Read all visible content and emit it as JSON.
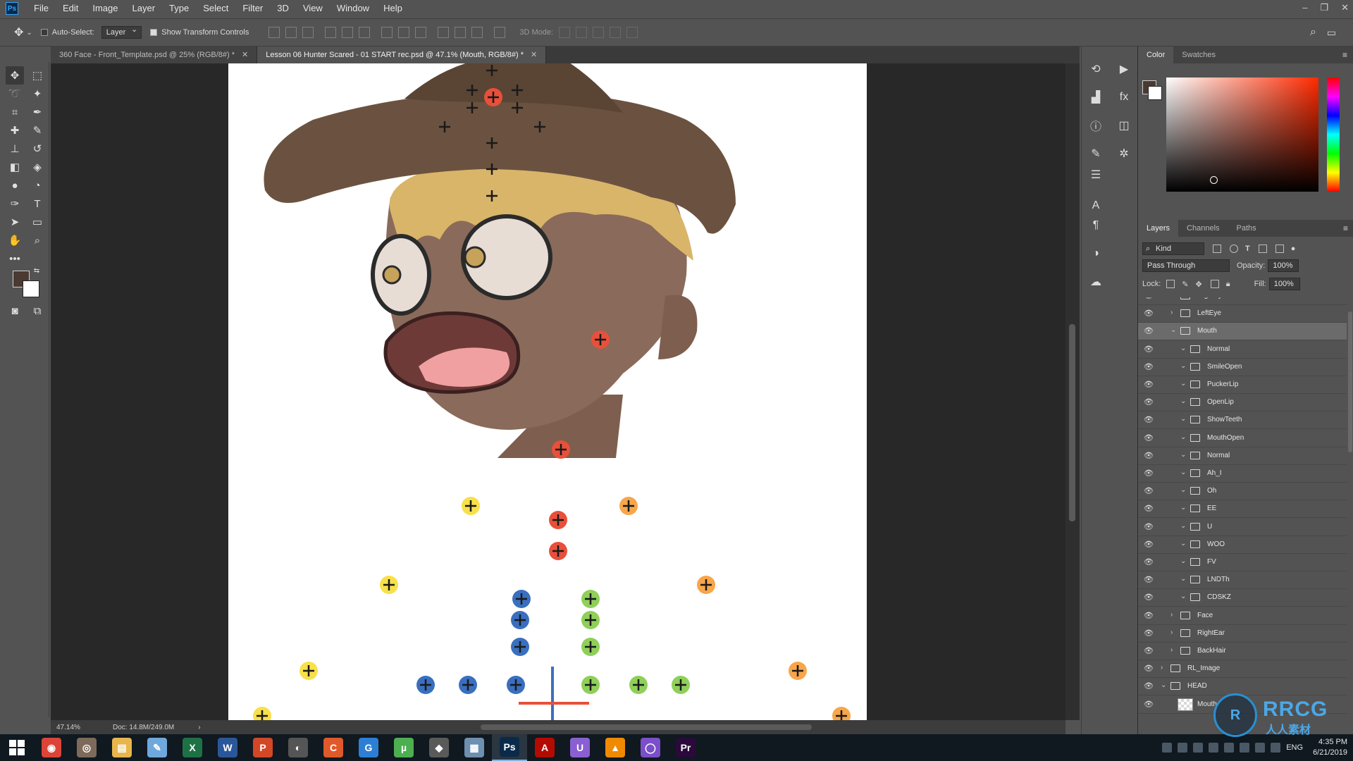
{
  "app": {
    "logo": "Ps"
  },
  "menu": [
    "File",
    "Edit",
    "Image",
    "Layer",
    "Type",
    "Select",
    "Filter",
    "3D",
    "View",
    "Window",
    "Help"
  ],
  "window_controls": [
    "–",
    "❐",
    "✕"
  ],
  "options": {
    "auto_select_label": "Auto-Select:",
    "auto_select_value": "Layer",
    "show_transform_label": "Show Transform Controls",
    "mode_3d_label": "3D Mode:"
  },
  "doc_tabs": [
    {
      "label": "360 Face - Front_Template.psd @ 25% (RGB/8#) *",
      "active": false
    },
    {
      "label": "Lesson 06 Hunter Scared - 01 START rec.psd @ 47.1% (Mouth, RGB/8#) *",
      "active": true
    }
  ],
  "status": {
    "zoom": "47.14%",
    "doc": "Doc: 14.8M/249.0M"
  },
  "color_panel": {
    "tabs": [
      "Color",
      "Swatches"
    ],
    "foreground": "#4a3a31",
    "background": "#ffffff"
  },
  "layers_panel": {
    "tabs": [
      "Layers",
      "Channels",
      "Paths"
    ],
    "kind_label": "Kind",
    "blend_mode": "Pass Through",
    "opacity_label": "Opacity:",
    "opacity_value": "100%",
    "lock_label": "Lock:",
    "fill_label": "Fill:",
    "fill_value": "100%",
    "layers": [
      {
        "name": "RightEye",
        "indent": 1,
        "expanded": false
      },
      {
        "name": "LeftEye",
        "indent": 1,
        "expanded": false
      },
      {
        "name": "Mouth",
        "indent": 1,
        "expanded": true,
        "selected": true
      },
      {
        "name": "Normal",
        "indent": 2,
        "expanded": true
      },
      {
        "name": "SmileOpen",
        "indent": 2,
        "expanded": true
      },
      {
        "name": "PuckerLip",
        "indent": 2,
        "expanded": true
      },
      {
        "name": "OpenLip",
        "indent": 2,
        "expanded": true
      },
      {
        "name": "ShowTeeth",
        "indent": 2,
        "expanded": true
      },
      {
        "name": "MouthOpen",
        "indent": 2,
        "expanded": true
      },
      {
        "name": "Normal",
        "indent": 2,
        "expanded": true
      },
      {
        "name": "Ah_I",
        "indent": 2,
        "expanded": true
      },
      {
        "name": "Oh",
        "indent": 2,
        "expanded": true
      },
      {
        "name": "EE",
        "indent": 2,
        "expanded": true
      },
      {
        "name": "U",
        "indent": 2,
        "expanded": true
      },
      {
        "name": "WOO",
        "indent": 2,
        "expanded": true
      },
      {
        "name": "FV",
        "indent": 2,
        "expanded": true
      },
      {
        "name": "LNDTh",
        "indent": 2,
        "expanded": true
      },
      {
        "name": "CDSKZ",
        "indent": 2,
        "expanded": true
      },
      {
        "name": "Face",
        "indent": 1,
        "expanded": false
      },
      {
        "name": "RightEar",
        "indent": 1,
        "expanded": false
      },
      {
        "name": "BackHair",
        "indent": 1,
        "expanded": false
      },
      {
        "name": "RL_Image",
        "indent": 0,
        "expanded": false
      },
      {
        "name": "HEAD",
        "indent": 0,
        "expanded": true
      },
      {
        "name": "Mouth",
        "indent": 1,
        "thumb": true
      }
    ]
  },
  "taskbar": {
    "apps": [
      {
        "name": "Chrome",
        "glyph": "◉",
        "color": "#db4437"
      },
      {
        "name": "Browser",
        "glyph": "◎",
        "color": "#7d6a5a"
      },
      {
        "name": "Explorer",
        "glyph": "▤",
        "color": "#e8b64c"
      },
      {
        "name": "Notes",
        "glyph": "✎",
        "color": "#6fa8dc"
      },
      {
        "name": "Excel",
        "glyph": "X",
        "color": "#1e7145"
      },
      {
        "name": "Word",
        "glyph": "W",
        "color": "#2b579a"
      },
      {
        "name": "PowerPoint",
        "glyph": "P",
        "color": "#d24726"
      },
      {
        "name": "Media",
        "glyph": "◐",
        "color": "#555555"
      },
      {
        "name": "Camtasia",
        "glyph": "C",
        "color": "#e0592a"
      },
      {
        "name": "Edge",
        "glyph": "G",
        "color": "#2d7fd3"
      },
      {
        "name": "uTorrent",
        "glyph": "µ",
        "color": "#4caf50"
      },
      {
        "name": "Tool",
        "glyph": "◆",
        "color": "#5a5a5a"
      },
      {
        "name": "Calculator",
        "glyph": "▦",
        "color": "#6d8fb0"
      },
      {
        "name": "Photoshop",
        "glyph": "Ps",
        "color": "#0b2a4a",
        "active": true
      },
      {
        "name": "Acrobat",
        "glyph": "A",
        "color": "#b30b00"
      },
      {
        "name": "Utility",
        "glyph": "U",
        "color": "#8a5fd1"
      },
      {
        "name": "VLC",
        "glyph": "▲",
        "color": "#f08a00"
      },
      {
        "name": "OBS",
        "glyph": "◯",
        "color": "#7a4fc9"
      },
      {
        "name": "Premiere",
        "glyph": "Pr",
        "color": "#2a0a3a"
      }
    ],
    "language": "ENG",
    "time": "4:35 PM",
    "date": "6/21/2019"
  },
  "watermark": {
    "text": "RRCG",
    "sub": "人人素材"
  },
  "colors": {
    "accent": "#31a8ff",
    "marker_yellow": "#f7e04a",
    "marker_red": "#e8503a",
    "marker_orange": "#f7a64a",
    "marker_blue": "#3a6fbf",
    "marker_green": "#8fcf5a"
  }
}
